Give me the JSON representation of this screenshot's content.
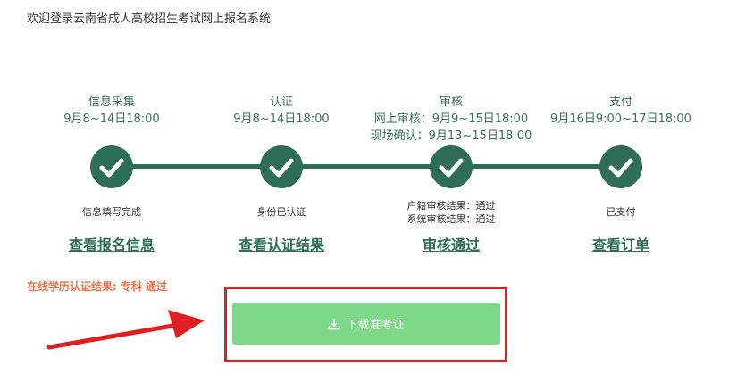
{
  "header": {
    "welcome_text": "欢迎登录云南省成人高校招生考试网上报名系统"
  },
  "steps": [
    {
      "title": "信息采集",
      "dates": [
        "9月8~14日18:00"
      ],
      "status": [
        "信息填写完成"
      ],
      "link": "查看报名信息"
    },
    {
      "title": "认证",
      "dates": [
        "9月8~14日18:00"
      ],
      "status": [
        "身份已认证"
      ],
      "link": "查看认证结果"
    },
    {
      "title": "审核",
      "dates": [
        "网上审核：9月9~15日18:00",
        "现场确认：9月13~15日18:00"
      ],
      "status": [
        "户籍审核结果：通过",
        "系统审核结果：通过"
      ],
      "link": "审核通过"
    },
    {
      "title": "支付",
      "dates": [
        "9月16日9:00~17日18:00"
      ],
      "status": [
        "已支付"
      ],
      "link": "查看订单"
    }
  ],
  "certification": {
    "result_text": "在线学历认证结果: 专科 通过"
  },
  "download": {
    "label": "下载准考证",
    "icon": "download-icon"
  },
  "colors": {
    "primary": "#2e6e56",
    "button": "#7dd88a",
    "highlight": "#e02020",
    "cert_text": "#e8724a"
  }
}
